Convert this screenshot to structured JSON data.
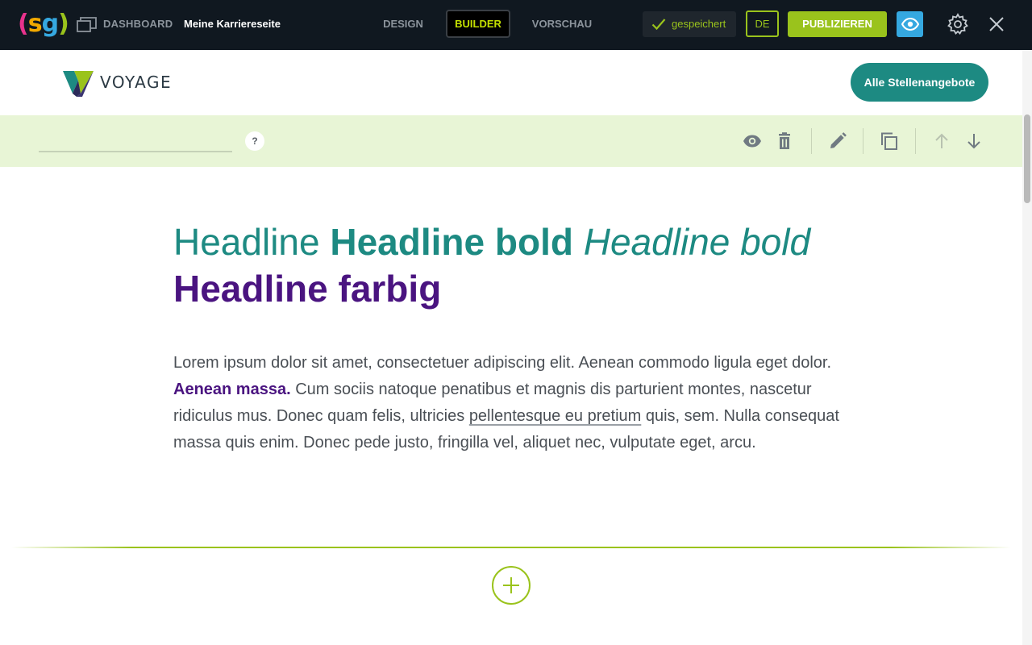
{
  "app": {
    "logo_text": "(sg)",
    "dashboard_label": "DASHBOARD",
    "site_title": "Meine Karriereseite",
    "tabs": [
      {
        "label": "DESIGN",
        "active": false
      },
      {
        "label": "BUILDER",
        "active": true
      },
      {
        "label": "VORSCHAU",
        "active": false
      }
    ],
    "saved_label": "gespeichert",
    "language": "DE",
    "publish_label": "PUBLIZIEREN",
    "icons": [
      "layers-icon",
      "check-icon",
      "eye-icon",
      "gear-icon",
      "close-icon"
    ],
    "colors": {
      "bar_bg": "#101820",
      "accent_green": "#9ac31c",
      "active_tab": "#c4e000",
      "eye_blue": "#35a8e0"
    }
  },
  "site": {
    "brand_name": "VOYAGE",
    "jobs_button_label": "Alle Stellenangebote",
    "colors": {
      "primary": "#1d8a82",
      "secondary": "#4a1480"
    }
  },
  "section_toolbar": {
    "name_value": "",
    "help_label": "?",
    "icons": [
      "eye-icon",
      "trash-icon",
      "pencil-icon",
      "copy-icon",
      "arrow-up-icon",
      "arrow-down-icon"
    ]
  },
  "content": {
    "headline": {
      "normal": "Headline",
      "bold": "Headline bold",
      "italic": "Headline bold",
      "colored": "Headline farbig"
    },
    "paragraph": {
      "part1": "Lorem ipsum dolor sit amet, consectetuer adipiscing elit. Aenean commodo ligula eget dolor.",
      "strong": "Aenean massa.",
      "part2": "Cum sociis natoque penatibus et magnis dis parturient montes, nascetur ridiculus mus. Donec quam felis, ultricies",
      "link": "pellentesque eu pretium",
      "part3": "quis, sem. Nulla consequat massa quis enim. Donec pede justo, fringilla vel, aliquet nec, vulputate eget, arcu."
    }
  }
}
